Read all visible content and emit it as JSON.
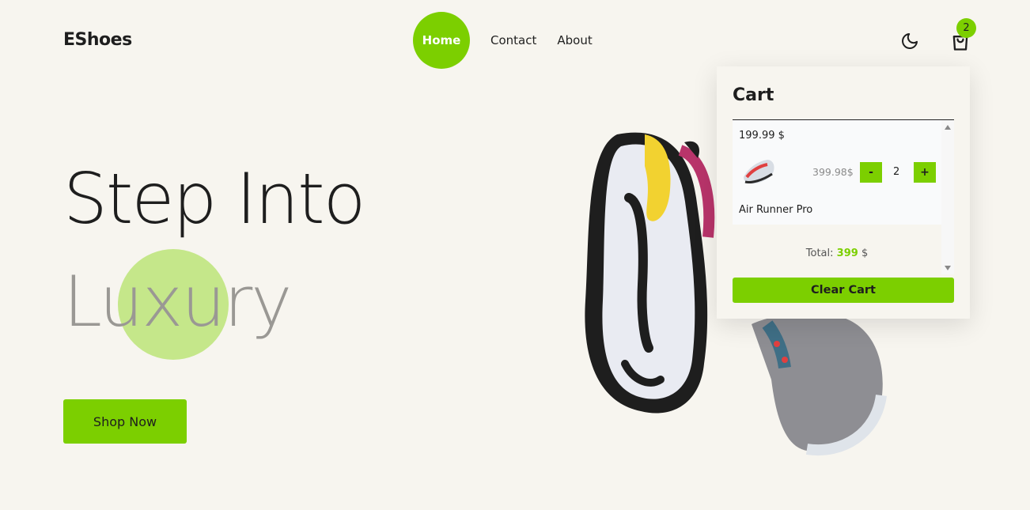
{
  "header": {
    "brand": "EShoes",
    "nav": [
      {
        "label": "Home"
      },
      {
        "label": "Contact"
      },
      {
        "label": "About"
      }
    ],
    "cart_count": "2",
    "icons": {
      "theme": "moon-icon",
      "cart": "shopping-bag-icon"
    }
  },
  "hero": {
    "title": "Step Into",
    "subtitle": "Luxury",
    "cta": "Shop Now"
  },
  "cart": {
    "title": "Cart",
    "items": [
      {
        "unit_price": "199.99 $",
        "subtotal": "399.98$",
        "decrement": "-",
        "quantity": "2",
        "increment": "+",
        "name": "Air Runner Pro"
      }
    ],
    "total_label": "Total:",
    "total_value": "399",
    "total_currency": "$",
    "clear_label": "Clear Cart"
  },
  "colors": {
    "accent": "#7ccf00",
    "background": "#f7f5ef",
    "accent_light": "#c5e78a"
  }
}
